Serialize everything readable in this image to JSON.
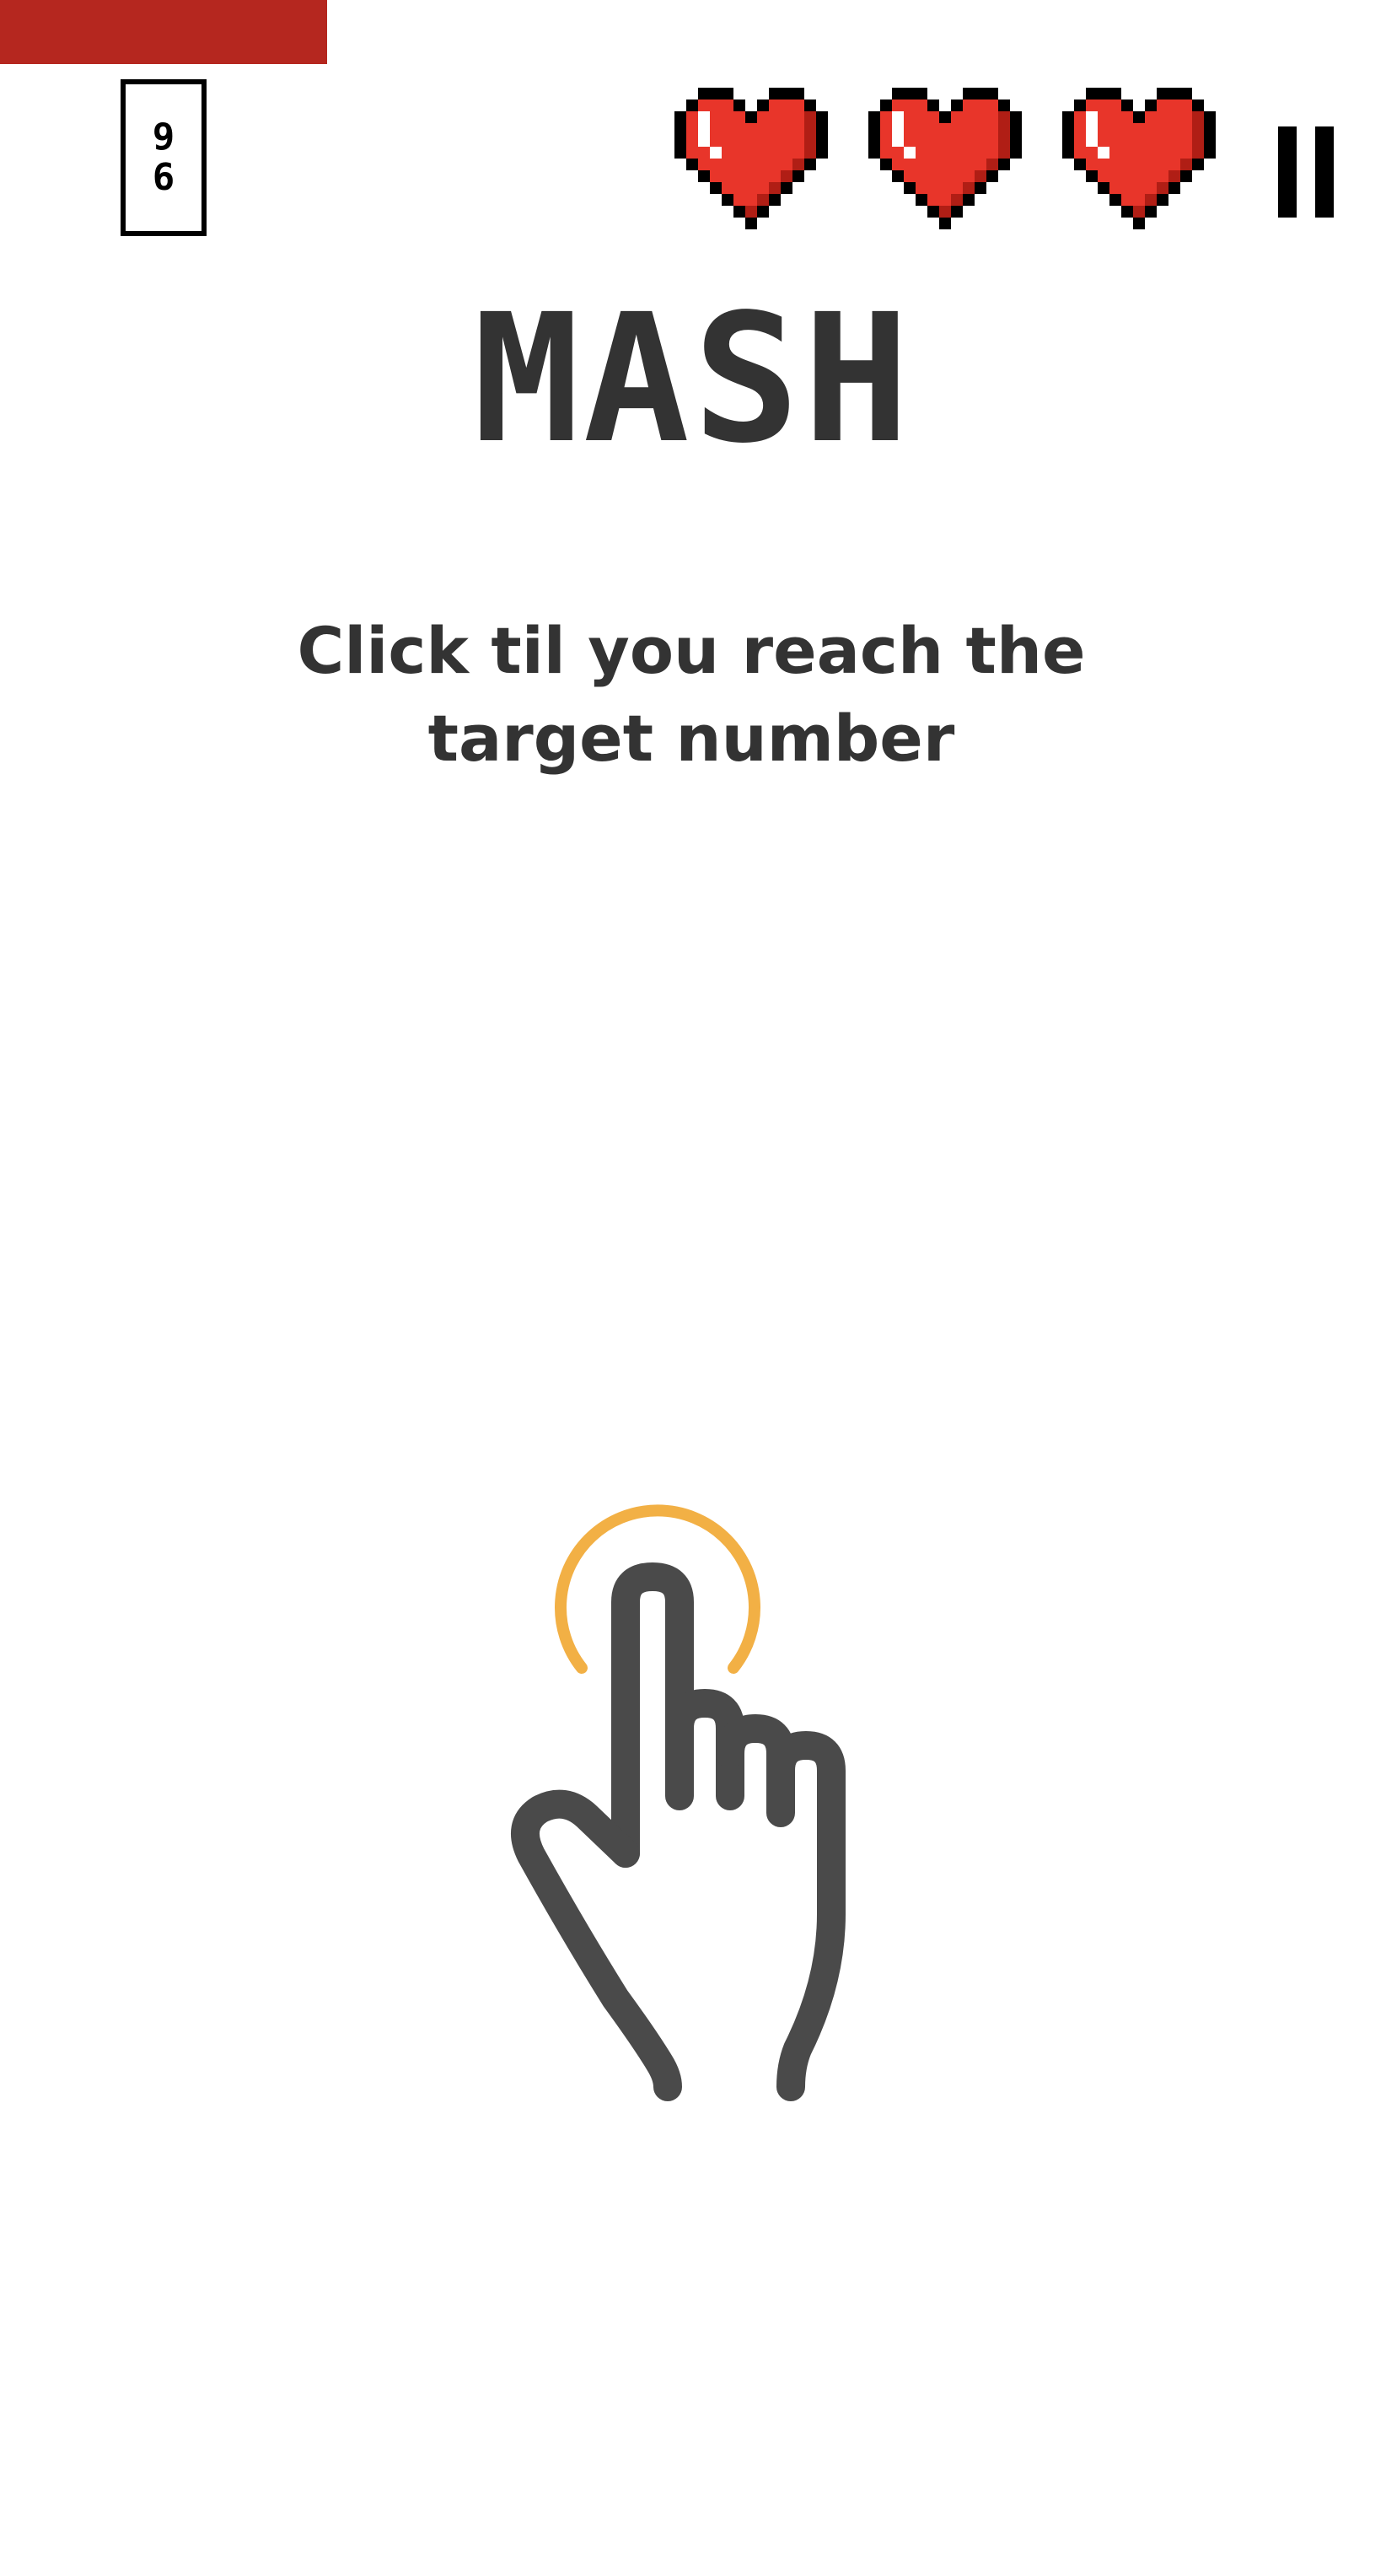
{
  "timer": {
    "remaining_fraction": 0.236
  },
  "score": {
    "digits": [
      "9",
      "6"
    ]
  },
  "lives": {
    "count": 3,
    "heart_color": "#e8352a",
    "icon": "pixel-heart-icon"
  },
  "pause": {
    "icon": "pause-icon"
  },
  "game": {
    "title": "MASH",
    "instruction": "Click til you reach the target number"
  },
  "tap_hint": {
    "icon": "tap-hand-icon",
    "ring_color": "#f2b045",
    "hand_color": "#4a4a4a"
  },
  "colors": {
    "timer_bar": "#b5271f",
    "text": "#333333"
  }
}
